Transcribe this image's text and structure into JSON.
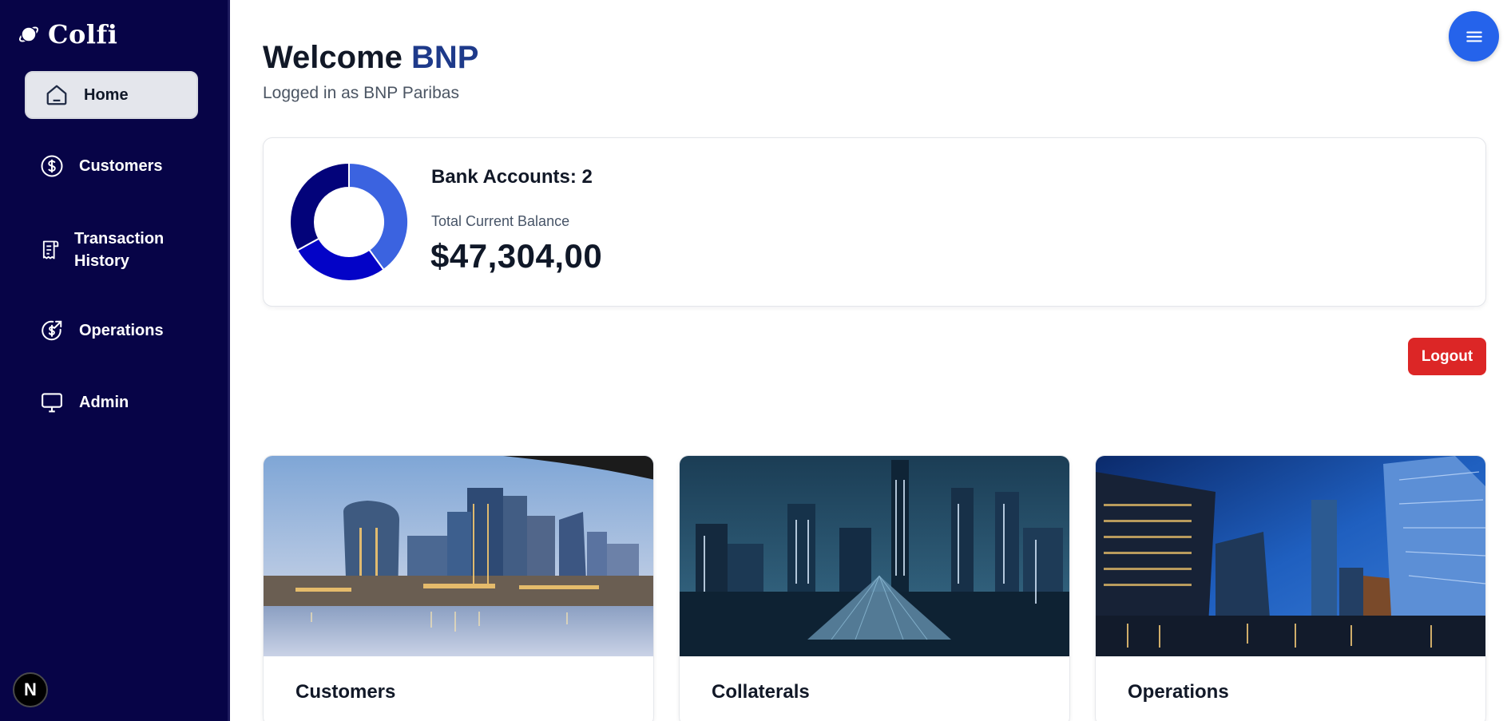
{
  "brand": {
    "name": "Colfi",
    "logo_icon": "orbit-logo-icon"
  },
  "sidebar": {
    "items": [
      {
        "label": "Home",
        "icon": "home-icon",
        "active": true
      },
      {
        "label": "Customers",
        "icon": "dollar-circle-icon",
        "active": false
      },
      {
        "label": "Transaction History",
        "icon": "receipt-icon",
        "active": false
      },
      {
        "label": "Operations",
        "icon": "dollar-send-icon",
        "active": false
      },
      {
        "label": "Admin",
        "icon": "monitor-icon",
        "active": false
      }
    ],
    "footer_badge": "N"
  },
  "header": {
    "welcome": "Welcome",
    "user": "BNP",
    "subtitle": "Logged in as BNP Paribas",
    "menu_icon": "hamburger-menu-icon"
  },
  "balance_card": {
    "accounts_label": "Bank Accounts: 2",
    "balance_label": "Total Current Balance",
    "balance_value": "$47,304,00"
  },
  "chart_data": {
    "type": "pie",
    "values": [
      40,
      27,
      33
    ],
    "colors": [
      "#3b63e0",
      "#0303c7",
      "#03037a"
    ]
  },
  "actions": {
    "logout_label": "Logout"
  },
  "tiles": [
    {
      "title": "Customers",
      "image": "london-skyline-dusk"
    },
    {
      "title": "Collaterals",
      "image": "beijing-skyline-night"
    },
    {
      "title": "Operations",
      "image": "skyscrapers-blue-hour"
    }
  ],
  "colors": {
    "sidebar_bg": "#070447",
    "accent_blue": "#1e3a8a",
    "fab_blue": "#2563eb",
    "logout_red": "#dc2626"
  }
}
